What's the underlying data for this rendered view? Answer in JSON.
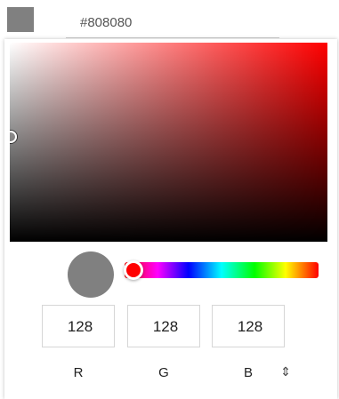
{
  "color": {
    "hex": "#808080",
    "swatch": "#808080",
    "hue_color": "#ff0000"
  },
  "rgb": [
    {
      "label": "R",
      "value": "128"
    },
    {
      "label": "G",
      "value": "128"
    },
    {
      "label": "B",
      "value": "128"
    }
  ],
  "format_toggle_icon": "updown-chevron-icon",
  "format_toggle_glyph": "⇕"
}
